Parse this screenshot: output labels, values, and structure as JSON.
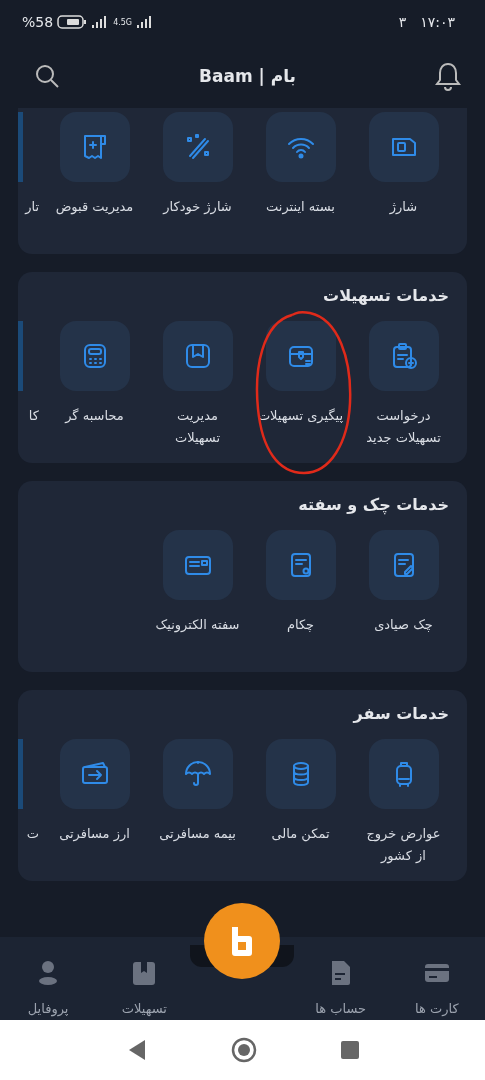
{
  "status_bar": {
    "battery": "%58",
    "network": "4.5G",
    "time": "۱۷:۰۳",
    "notification_count": "۳"
  },
  "header": {
    "title": "Baam | بام"
  },
  "sections": [
    {
      "items": [
        {
          "kind": "full",
          "label": "شارژ",
          "circled": false
        },
        {
          "kind": "full",
          "label": "بسته اینترنت",
          "circled": false
        },
        {
          "kind": "full",
          "label": "شارژ خودکار",
          "circled": false
        },
        {
          "kind": "full",
          "label": "مدیریت قبوض",
          "circled": false
        },
        {
          "kind": "partial",
          "label": "تار",
          "circled": false
        }
      ]
    },
    {
      "title": "خدمات تسهیلات",
      "items": [
        {
          "kind": "full",
          "label": "درخواست تسهیلات جدید",
          "circled": false
        },
        {
          "kind": "full",
          "label": "پیگیری تسهیلات",
          "circled": true
        },
        {
          "kind": "full",
          "label": "مدیریت تسهیلات",
          "circled": false
        },
        {
          "kind": "full",
          "label": "محاسبه گر",
          "circled": false
        },
        {
          "kind": "partial",
          "label": "کا",
          "circled": false
        }
      ]
    },
    {
      "title": "خدمات چک و سفته",
      "items": [
        {
          "kind": "full",
          "label": "چک صیادی",
          "circled": false
        },
        {
          "kind": "full",
          "label": "چکام",
          "circled": false
        },
        {
          "kind": "full",
          "label": "سفته الکترونیک",
          "circled": false
        }
      ]
    },
    {
      "title": "خدمات سفر",
      "items": [
        {
          "kind": "full",
          "label": "عوارض خروج از کشور",
          "circled": false
        },
        {
          "kind": "full",
          "label": "تمکن مالی",
          "circled": false
        },
        {
          "kind": "full",
          "label": "بیمه مسافرتی",
          "circled": false
        },
        {
          "kind": "full",
          "label": "ارز مسافرتی",
          "circled": false
        },
        {
          "kind": "partial",
          "label": "ت",
          "circled": false
        }
      ]
    }
  ],
  "bottom_nav": [
    {
      "label": "کارت ها",
      "selected": false
    },
    {
      "label": "حساب ها",
      "selected": false
    },
    {
      "label": "تسهیلات",
      "selected": false
    },
    {
      "label": "پروفایل",
      "selected": false
    }
  ]
}
